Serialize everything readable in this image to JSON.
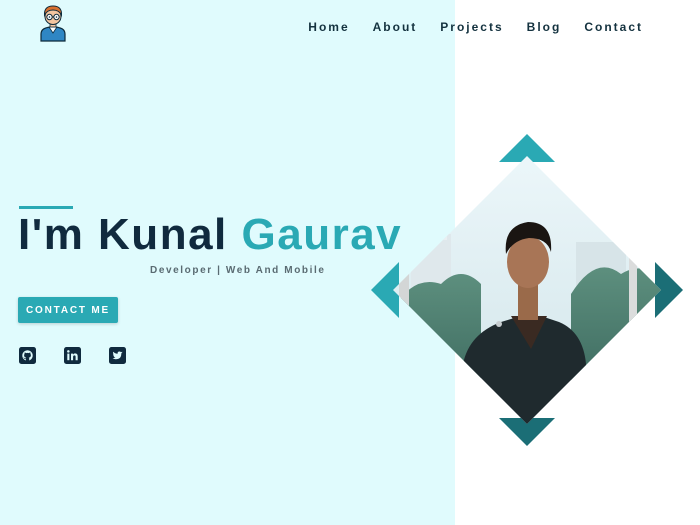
{
  "nav": {
    "items": [
      {
        "label": "Home"
      },
      {
        "label": "About"
      },
      {
        "label": "Projects"
      },
      {
        "label": "Blog"
      },
      {
        "label": "Contact"
      }
    ]
  },
  "hero": {
    "greeting": "I'm Kunal",
    "highlight": "Gaurav",
    "subtitle": "Developer | Web And Mobile",
    "cta_label": "CONTACT ME"
  },
  "social": [
    {
      "icon": "github-icon"
    },
    {
      "icon": "linkedin-icon"
    },
    {
      "icon": "twitter-icon"
    }
  ],
  "colors": {
    "accent": "#2aa9b4",
    "accent_dark": "#1b6e76",
    "heading": "#102a3e",
    "left_background": "#e0fbfd"
  }
}
